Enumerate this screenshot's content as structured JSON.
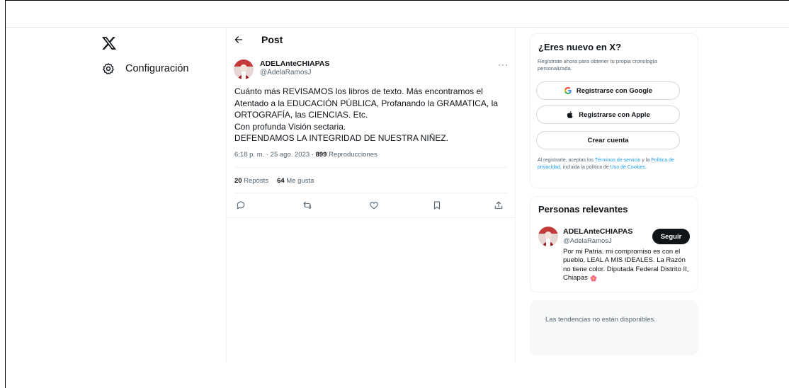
{
  "nav": {
    "logo_icon": "x-logo-icon",
    "settings_icon": "gear-icon",
    "settings_label": "Configuración"
  },
  "header": {
    "back_icon": "arrow-left-icon",
    "title": "Post"
  },
  "tweet": {
    "author_name": "ADELAnteCHIAPAS",
    "author_handle": "@AdelaRamosJ",
    "more_label": "···",
    "text_lines": [
      "Cuánto más REVISAMOS los libros de texto. Más encontramos el",
      "Atentado a la EDUCACIÓN PÚBLICA, Profanando la GRAMATICA, la",
      "ORTOGRAFÍA, las CIENCIAS. Etc.",
      "Con profunda Visión sectaria.",
      "DEFENDAMOS LA INTEGRIDAD DE NUESTRA NIÑEZ."
    ],
    "timestamp": "6:18 p. m. · 25 ago. 2023 · ",
    "views_count": "899",
    "views_label": " Reproducciones",
    "reposts_count": "20",
    "reposts_label": " Reposts",
    "likes_count": "64",
    "likes_label": " Me gusta",
    "actions": [
      "reply-icon",
      "repost-icon",
      "like-icon",
      "bookmark-icon",
      "share-icon"
    ]
  },
  "signup": {
    "heading": "¿Eres nuevo en X?",
    "subtext": "Regístrate ahora para obtener tu propia cronología personalizada.",
    "google_label": "Registrarse con Google",
    "apple_label": "Registrarse con Apple",
    "create_label": "Crear cuenta",
    "legal_prefix": "Al registrarte, aceptas los ",
    "terms_link": "Términos de servicio",
    "legal_mid1": " y la ",
    "privacy_link": "Política de privacidad",
    "legal_mid2": ", incluida la política de ",
    "cookies_link": "Uso de Cookies",
    "legal_suffix": "."
  },
  "people": {
    "heading": "Personas relevantes",
    "name": "ADELAnteCHIAPAS",
    "handle": "@AdelaRamosJ",
    "follow_label": "Seguir",
    "bio": "Por mi Patria. mi compromiso es con el pueblo, LEAL A MIS IDEALES. La Razón no tiene color. Diputada Federal Distrito II, Chiapas "
  },
  "trends": {
    "message": "Las tendencias no están disponibles."
  },
  "colors": {
    "accent": "#1d9bf0",
    "text": "#0f1419",
    "muted": "#536471",
    "border": "#eff3f4"
  }
}
